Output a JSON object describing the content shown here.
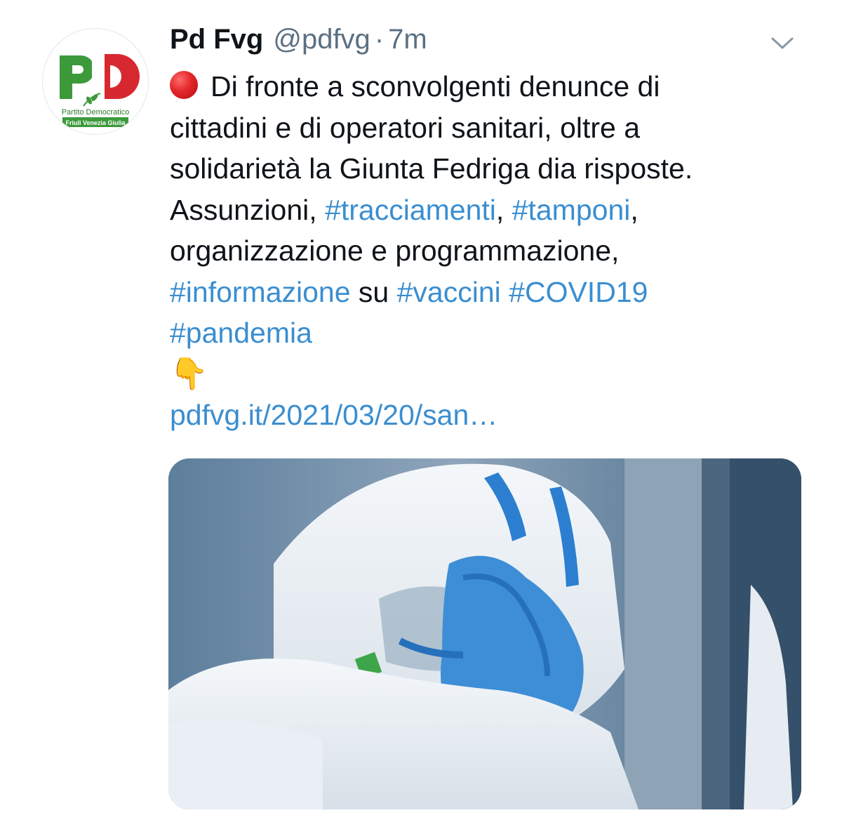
{
  "tweet": {
    "author": {
      "display_name": "Pd Fvg",
      "handle": "@pdfvg",
      "separator": "·",
      "time": "7m",
      "avatar": {
        "logo_letters": "PD",
        "party_name": "Partito Democratico",
        "region": "Friuli Venezia Giulia",
        "colors": {
          "green": "#3c9a3a",
          "red": "#d7282f",
          "white": "#ffffff"
        }
      }
    },
    "more_icon": "chevron-down-icon",
    "lines": [
      {
        "segments": [
          {
            "text": "Di fronte a sconvolgenti denunce di",
            "type": "text"
          }
        ],
        "prefix_icon": "red-circle-emoji"
      },
      {
        "segments": [
          {
            "text": "cittadini e di operatori sanitari, oltre a",
            "type": "text"
          }
        ]
      },
      {
        "segments": [
          {
            "text": "solidarietà la Giunta Fedriga dia risposte.",
            "type": "text"
          }
        ]
      },
      {
        "segments": [
          {
            "text": "Assunzioni, ",
            "type": "text"
          },
          {
            "text": "#tracciamenti",
            "type": "hashtag"
          },
          {
            "text": ", ",
            "type": "text"
          },
          {
            "text": "#tamponi",
            "type": "hashtag"
          },
          {
            "text": ",",
            "type": "text"
          }
        ]
      },
      {
        "segments": [
          {
            "text": "organizzazione e programmazione,",
            "type": "text"
          }
        ]
      },
      {
        "segments": [
          {
            "text": "#informazione",
            "type": "hashtag"
          },
          {
            "text": " su ",
            "type": "text"
          },
          {
            "text": "#vaccini",
            "type": "hashtag"
          },
          {
            "text": " ",
            "type": "text"
          },
          {
            "text": "#COVID19",
            "type": "hashtag"
          }
        ]
      },
      {
        "segments": [
          {
            "text": "#pandemia",
            "type": "hashtag"
          }
        ]
      },
      {
        "segments": [
          {
            "text": "👇",
            "type": "emoji"
          }
        ]
      },
      {
        "segments": [
          {
            "text": "pdfvg.it/2021/03/20/san…",
            "type": "link"
          }
        ]
      }
    ],
    "colors": {
      "text": "#0f1419",
      "secondary": "#5b7083",
      "link": "#3a8ed0"
    },
    "media": {
      "kind": "photo"
    }
  }
}
